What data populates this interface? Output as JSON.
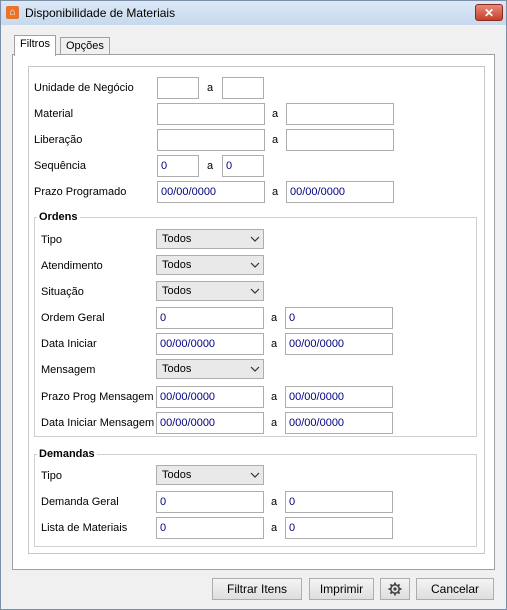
{
  "window": {
    "title": "Disponibilidade de Materiais",
    "close_glyph": "✕"
  },
  "tabs": [
    {
      "label": "Filtros"
    },
    {
      "label": "Opções"
    }
  ],
  "sep": "a",
  "filters": {
    "unidade_label": "Unidade de Negócio",
    "unidade_from": "",
    "unidade_to": "",
    "material_label": "Material",
    "material_from": "",
    "material_to": "",
    "liberacao_label": "Liberação",
    "liberacao_from": "",
    "liberacao_to": "",
    "sequencia_label": "Sequência",
    "sequencia_from": "0",
    "sequencia_to": "0",
    "prazo_label": "Prazo Programado",
    "prazo_from": "00/00/0000",
    "prazo_to": "00/00/0000"
  },
  "ordens": {
    "title": "Ordens",
    "tipo_label": "Tipo",
    "tipo_value": "Todos",
    "atendimento_label": "Atendimento",
    "atendimento_value": "Todos",
    "situacao_label": "Situação",
    "situacao_value": "Todos",
    "ordem_geral_label": "Ordem Geral",
    "ordem_geral_from": "0",
    "ordem_geral_to": "0",
    "data_iniciar_label": "Data Iniciar",
    "data_iniciar_from": "00/00/0000",
    "data_iniciar_to": "00/00/0000",
    "mensagem_label": "Mensagem",
    "mensagem_value": "Todos",
    "prazo_msg_label": "Prazo Prog Mensagem",
    "prazo_msg_from": "00/00/0000",
    "prazo_msg_to": "00/00/0000",
    "data_ini_msg_label": "Data Iniciar Mensagem",
    "data_ini_msg_from": "00/00/0000",
    "data_ini_msg_to": "00/00/0000"
  },
  "demandas": {
    "title": "Demandas",
    "tipo_label": "Tipo",
    "tipo_value": "Todos",
    "demanda_geral_label": "Demanda Geral",
    "demanda_geral_from": "0",
    "demanda_geral_to": "0",
    "lista_label": "Lista de Materiais",
    "lista_from": "0",
    "lista_to": "0"
  },
  "buttons": {
    "filtrar": "Filtrar Itens",
    "imprimir": "Imprimir",
    "settings_icon": "gear-icon",
    "cancelar": "Cancelar"
  }
}
